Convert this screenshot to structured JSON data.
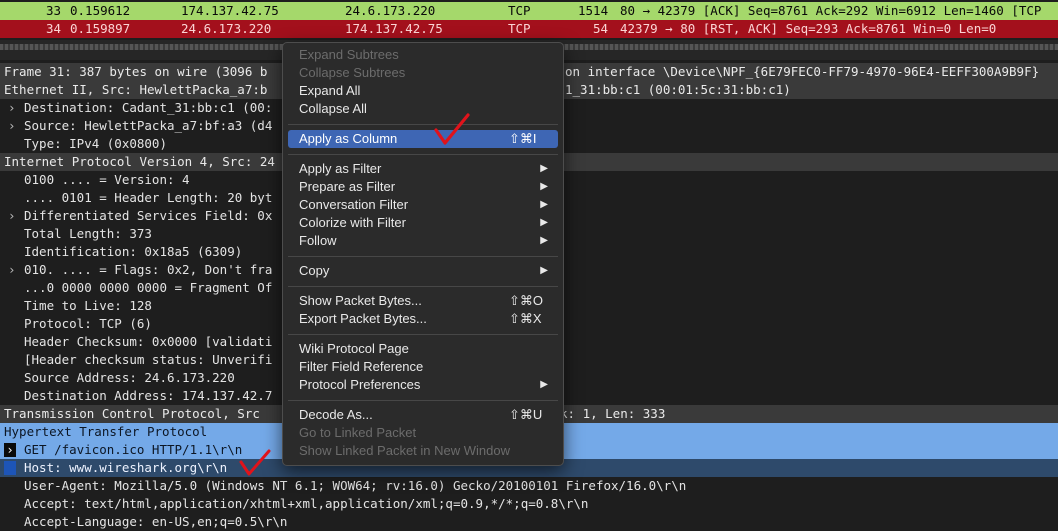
{
  "packet_list": {
    "rows": [
      {
        "no": "33",
        "time": "0.159612",
        "src": "174.137.42.75",
        "dst": "24.6.173.220",
        "proto": "TCP",
        "len": "1514",
        "info": "80 → 42379 [ACK] Seq=8761 Ack=292 Win=6912 Len=1460 [TCP"
      },
      {
        "no": "34",
        "time": "0.159897",
        "src": "24.6.173.220",
        "dst": "174.137.42.75",
        "proto": "TCP",
        "len": "54",
        "info": "42379 → 80 [RST, ACK] Seq=293 Ack=8761 Win=0 Len=0"
      }
    ]
  },
  "details": {
    "frame_line": "Frame 31: 387 bytes on wire (3096 b",
    "frame_line_tail": "on interface \\Device\\NPF_{6E79FEC0-FF79-4970-96E4-EEFF300A9B9F}",
    "ethernet": "Ethernet II, Src: HewlettPacka_a7:b",
    "ethernet_tail": "1_31:bb:c1 (00:01:5c:31:bb:c1)",
    "eth_dst": "Destination: Cadant_31:bb:c1 (00:",
    "eth_src": "Source: HewlettPacka_a7:bf:a3 (d4",
    "eth_type": "Type: IPv4 (0x0800)",
    "ip": "Internet Protocol Version 4, Src: 24",
    "ip_version": "0100 .... = Version: 4",
    "ip_hlen": ".... 0101 = Header Length: 20 byt",
    "ip_dsf": "Differentiated Services Field: 0x",
    "ip_total": "Total Length: 373",
    "ip_id": "Identification: 0x18a5 (6309)",
    "ip_flags": "010. .... = Flags: 0x2, Don't fra",
    "ip_frag": "...0 0000 0000 0000 = Fragment Of",
    "ip_ttl": "Time to Live: 128",
    "ip_proto": "Protocol: TCP (6)",
    "ip_chk": "Header Checksum: 0x0000 [validati",
    "ip_chk_status": "[Header checksum status: Unverifi",
    "ip_srcaddr": "Source Address: 24.6.173.220",
    "ip_dstaddr": "Destination Address: 174.137.42.7",
    "tcp": "Transmission Control Protocol, Src",
    "tcp_tail": "k: 1, Len: 333",
    "http": "Hypertext Transfer Protocol",
    "http_get": "GET /favicon.ico HTTP/1.1\\r\\n",
    "http_host": "Host: www.wireshark.org\\r\\n",
    "http_ua": "User-Agent: Mozilla/5.0 (Windows NT 6.1; WOW64; rv:16.0) Gecko/20100101 Firefox/16.0\\r\\n",
    "http_accept": "Accept: text/html,application/xhtml+xml,application/xml;q=0.9,*/*;q=0.8\\r\\n",
    "http_lang": "Accept-Language: en-US,en;q=0.5\\r\\n"
  },
  "context_menu": {
    "expand_subtrees": "Expand Subtrees",
    "collapse_subtrees": "Collapse Subtrees",
    "expand_all": "Expand All",
    "collapse_all": "Collapse All",
    "apply_as_column": "Apply as Column",
    "apply_as_column_sc": "⇧⌘I",
    "apply_as_filter": "Apply as Filter",
    "prepare_as_filter": "Prepare as Filter",
    "conversation_filter": "Conversation Filter",
    "colorize_with_filter": "Colorize with Filter",
    "follow": "Follow",
    "copy": "Copy",
    "show_packet_bytes": "Show Packet Bytes...",
    "show_packet_bytes_sc": "⇧⌘O",
    "export_packet_bytes": "Export Packet Bytes...",
    "export_packet_bytes_sc": "⇧⌘X",
    "wiki_protocol_page": "Wiki Protocol Page",
    "filter_field_reference": "Filter Field Reference",
    "protocol_preferences": "Protocol Preferences",
    "decode_as": "Decode As...",
    "decode_as_sc": "⇧⌘U",
    "go_to_linked_packet": "Go to Linked Packet",
    "show_linked_packet_new_window": "Show Linked Packet in New Window",
    "submenu_arrow": "▶"
  },
  "colors": {
    "row_green": "#a5d86b",
    "row_red": "#a3101c",
    "highlight_blue": "#74a9e8",
    "menu_active": "#3e66b4",
    "annotation_check": "#e0131b"
  }
}
